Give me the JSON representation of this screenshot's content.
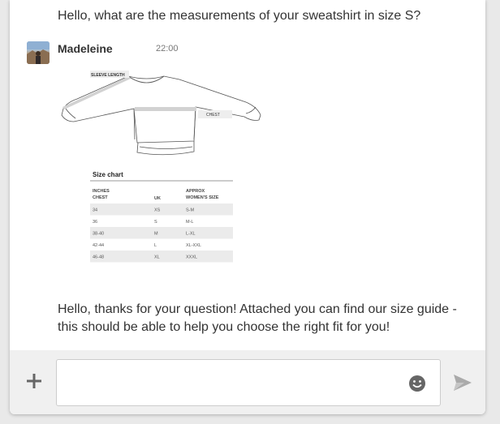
{
  "previous_message": {
    "text": "Hello, what are the measurements of your sweatshirt in size S?"
  },
  "message": {
    "sender": "Madeleine",
    "time": "22:00",
    "attachment": {
      "sleeve_label": "SLEEVE LENGTH",
      "chest_label": "CHEST",
      "size_chart": {
        "title": "Size chart",
        "headers": [
          "INCHES CHEST",
          "UK",
          "APPROX WOMEN'S SIZE"
        ],
        "header_lines": [
          [
            "INCHES",
            "CHEST"
          ],
          [
            "UK"
          ],
          [
            "APPROX",
            "WOMEN'S SIZE"
          ]
        ],
        "rows": [
          [
            "34",
            "XS",
            "S-M"
          ],
          [
            "36",
            "S",
            "M-L"
          ],
          [
            "38-40",
            "M",
            "L-XL"
          ],
          [
            "42-44",
            "L",
            "XL-XXL"
          ],
          [
            "46-48",
            "XL",
            "XXXL"
          ]
        ]
      }
    },
    "text": "Hello, thanks for your question! Attached you can find our size guide - this should be able to help you choose the right fit for you!"
  },
  "composer": {
    "placeholder": "",
    "plus_icon": "plus-icon",
    "emoji_icon": "smiley-icon",
    "send_icon": "send-icon"
  },
  "colors": {
    "panel_background": "#ffffff",
    "page_background": "#e9e9e9",
    "input_bar_background": "#f0f0f0",
    "icon_gray": "#666666",
    "send_icon_gray": "#aaaaaa"
  }
}
